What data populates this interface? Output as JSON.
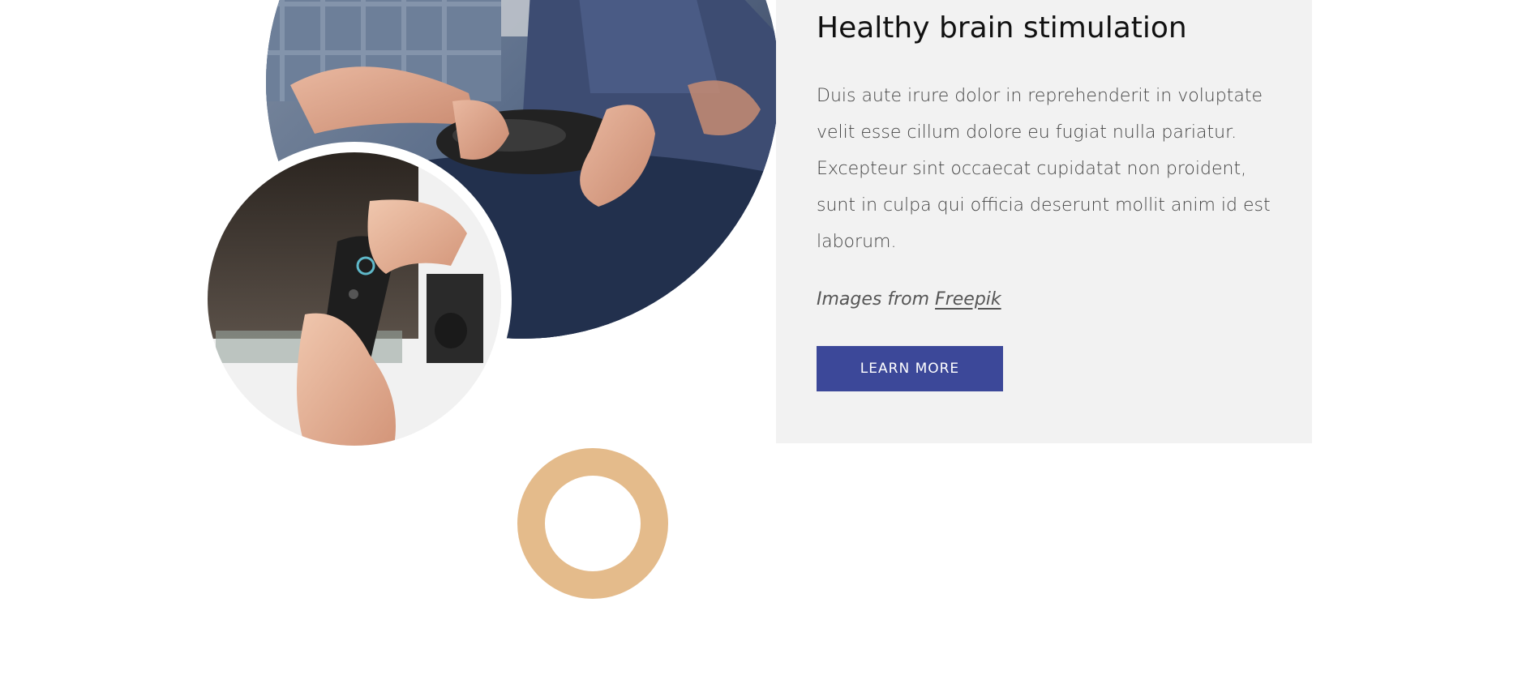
{
  "card": {
    "title": "Healthy brain stimulation",
    "body": "Duis aute irure dolor in reprehenderit in voluptate velit esse cillum dolore eu fugiat nulla pariatur. Excepteur sint occaecat cupidatat non proident, sunt in culpa qui officia deserunt mollit anim id est laborum.",
    "credit_prefix": "Images from",
    "credit_link": "Freepik",
    "button_label": "LEARN MORE"
  },
  "colors": {
    "card_background": "#f2f2f2",
    "button": "#3c4899",
    "decor_ring": "#e4bb8b"
  }
}
